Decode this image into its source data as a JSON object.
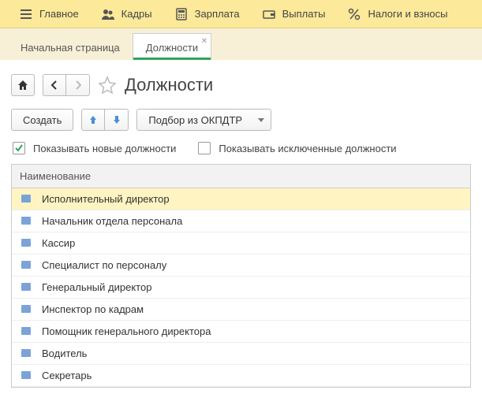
{
  "topnav": [
    {
      "label": "Главное",
      "icon": "menu"
    },
    {
      "label": "Кадры",
      "icon": "people"
    },
    {
      "label": "Зарплата",
      "icon": "calc"
    },
    {
      "label": "Выплаты",
      "icon": "wallet"
    },
    {
      "label": "Налоги и взносы",
      "icon": "percent"
    }
  ],
  "tabs": [
    {
      "label": "Начальная страница",
      "active": false
    },
    {
      "label": "Должности",
      "active": true
    }
  ],
  "page_title": "Должности",
  "toolbar": {
    "create": "Создать",
    "pick": "Подбор из ОКПДТР"
  },
  "filters": {
    "show_new": {
      "label": "Показывать новые должности",
      "checked": true
    },
    "show_excluded": {
      "label": "Показывать исключенные должности",
      "checked": false
    }
  },
  "grid": {
    "header": "Наименование",
    "rows": [
      {
        "name": "Исполнительный директор",
        "selected": true
      },
      {
        "name": "Начальник отдела персонала",
        "selected": false
      },
      {
        "name": "Кассир",
        "selected": false
      },
      {
        "name": "Специалист по персоналу",
        "selected": false
      },
      {
        "name": "Генеральный директор",
        "selected": false
      },
      {
        "name": "Инспектор по кадрам",
        "selected": false
      },
      {
        "name": "Помощник генерального директора",
        "selected": false
      },
      {
        "name": "Водитель",
        "selected": false
      },
      {
        "name": "Секретарь",
        "selected": false
      }
    ]
  }
}
